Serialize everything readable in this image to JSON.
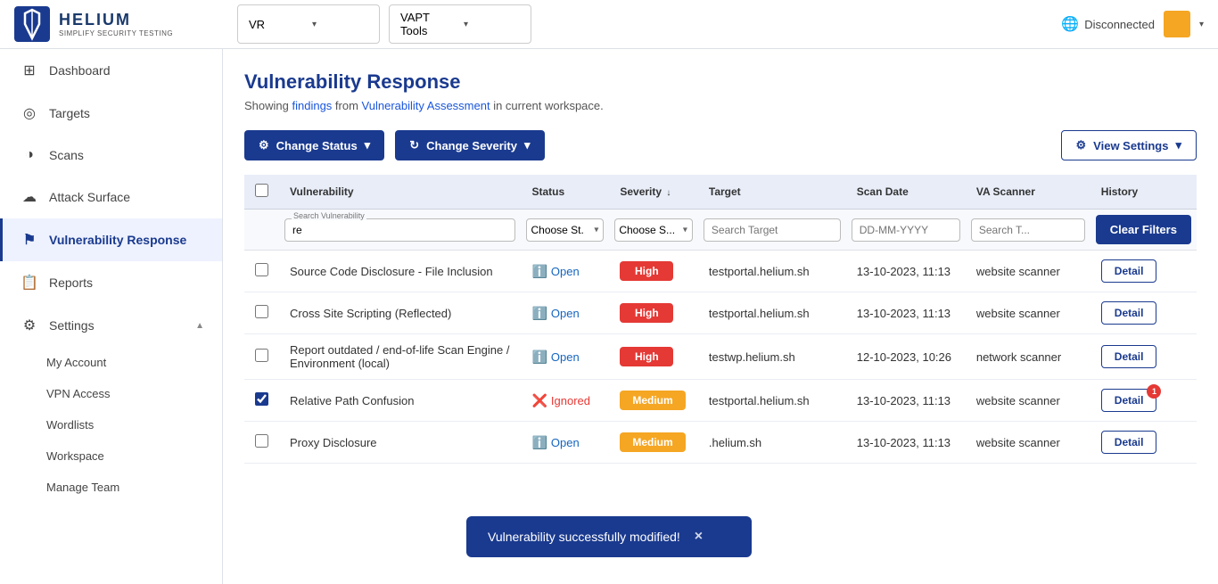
{
  "brand": {
    "title": "HELIUM",
    "subtitle": "SIMPLIFY SECURITY TESTING"
  },
  "navbar": {
    "workspace_label": "VR",
    "tools_label": "VAPT Tools",
    "connection_status": "Disconnected"
  },
  "sidebar": {
    "items": [
      {
        "id": "dashboard",
        "label": "Dashboard",
        "icon": "⊞",
        "active": false
      },
      {
        "id": "targets",
        "label": "Targets",
        "icon": "◎",
        "active": false
      },
      {
        "id": "scans",
        "label": "Scans",
        "icon": "◑",
        "active": false
      },
      {
        "id": "attack-surface",
        "label": "Attack Surface",
        "icon": "☁",
        "active": false
      },
      {
        "id": "vulnerability-response",
        "label": "Vulnerability Response",
        "icon": "⚑",
        "active": true
      },
      {
        "id": "reports",
        "label": "Reports",
        "icon": "📋",
        "active": false
      },
      {
        "id": "settings",
        "label": "Settings",
        "icon": "⚙",
        "active": false,
        "expanded": true
      }
    ],
    "settings_submenu": [
      {
        "id": "my-account",
        "label": "My Account"
      },
      {
        "id": "vpn-access",
        "label": "VPN Access"
      },
      {
        "id": "wordlists",
        "label": "Wordlists"
      },
      {
        "id": "workspace",
        "label": "Workspace"
      },
      {
        "id": "manage-team",
        "label": "Manage Team"
      }
    ]
  },
  "page": {
    "title": "Vulnerability Response",
    "subtitle_pre": "Showing ",
    "subtitle_link1": "findings",
    "subtitle_mid": " from ",
    "subtitle_link2": "Vulnerability Assessment",
    "subtitle_post": " in current workspace."
  },
  "toolbar": {
    "change_status_label": "Change Status",
    "change_severity_label": "Change Severity",
    "view_settings_label": "View Settings"
  },
  "table": {
    "columns": [
      {
        "id": "checkbox",
        "label": ""
      },
      {
        "id": "vulnerability",
        "label": "Vulnerability"
      },
      {
        "id": "status",
        "label": "Status"
      },
      {
        "id": "severity",
        "label": "Severity",
        "sort": true
      },
      {
        "id": "target",
        "label": "Target"
      },
      {
        "id": "scan-date",
        "label": "Scan Date"
      },
      {
        "id": "va-scanner",
        "label": "VA Scanner"
      },
      {
        "id": "history",
        "label": "History"
      }
    ],
    "filters": {
      "vulnerability_placeholder": "Search Vulnerability",
      "vulnerability_value": "re",
      "status_placeholder": "Choose St...",
      "severity_placeholder": "Choose S...",
      "target_placeholder": "Search Target",
      "date_placeholder": "DD-MM-YYYY",
      "scanner_placeholder": "Search T...",
      "clear_label": "Clear Filters"
    },
    "rows": [
      {
        "id": 1,
        "checked": false,
        "vulnerability": "Source Code Disclosure - File Inclusion",
        "status": "Open",
        "status_type": "open",
        "severity": "High",
        "severity_type": "high",
        "target": "testportal.helium.sh",
        "scan_date": "13-10-2023, 11:13",
        "va_scanner": "website scanner",
        "detail_label": "Detail",
        "badge_count": null
      },
      {
        "id": 2,
        "checked": false,
        "vulnerability": "Cross Site Scripting (Reflected)",
        "status": "Open",
        "status_type": "open",
        "severity": "High",
        "severity_type": "high",
        "target": "testportal.helium.sh",
        "scan_date": "13-10-2023, 11:13",
        "va_scanner": "website scanner",
        "detail_label": "Detail",
        "badge_count": null
      },
      {
        "id": 3,
        "checked": false,
        "vulnerability": "Report outdated / end-of-life Scan Engine / Environment (local)",
        "status": "Open",
        "status_type": "open",
        "severity": "High",
        "severity_type": "high",
        "target": "testwp.helium.sh",
        "scan_date": "12-10-2023, 10:26",
        "va_scanner": "network scanner",
        "detail_label": "Detail",
        "badge_count": null
      },
      {
        "id": 4,
        "checked": true,
        "vulnerability": "Relative Path Confusion",
        "status": "Ignored",
        "status_type": "ignored",
        "severity": "Medium",
        "severity_type": "medium",
        "target": "testportal.helium.sh",
        "scan_date": "13-10-2023, 11:13",
        "va_scanner": "website scanner",
        "detail_label": "Detail",
        "badge_count": 1
      },
      {
        "id": 5,
        "checked": false,
        "vulnerability": "Proxy Disclosure",
        "status": "Open",
        "status_type": "open",
        "severity": "Medium",
        "severity_type": "medium",
        "target": ".helium.sh",
        "scan_date": "13-10-2023, 11:13",
        "va_scanner": "website scanner",
        "detail_label": "Detail",
        "badge_count": null
      }
    ]
  },
  "toast": {
    "message": "Vulnerability successfully modified!",
    "close_label": "×"
  }
}
